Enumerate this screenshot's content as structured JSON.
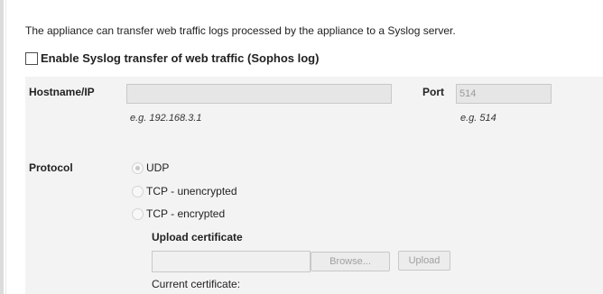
{
  "intro_text": "The appliance can transfer web traffic logs processed by the appliance to a Syslog server.",
  "enable_checkbox": {
    "label": "Enable Syslog transfer of web traffic (Sophos log)",
    "checked": false
  },
  "hostname": {
    "label": "Hostname/IP",
    "value": "",
    "hint": "e.g. 192.168.3.1"
  },
  "port": {
    "label": "Port",
    "value": "514",
    "hint": "e.g. 514"
  },
  "protocol": {
    "label": "Protocol",
    "options": [
      {
        "label": "UDP",
        "selected": true
      },
      {
        "label": "TCP - unencrypted",
        "selected": false
      },
      {
        "label": "TCP - encrypted",
        "selected": false
      }
    ]
  },
  "certificate": {
    "title": "Upload certificate",
    "file_value": "",
    "browse_label": "Browse...",
    "upload_label": "Upload",
    "current_label": "Current certificate:"
  }
}
